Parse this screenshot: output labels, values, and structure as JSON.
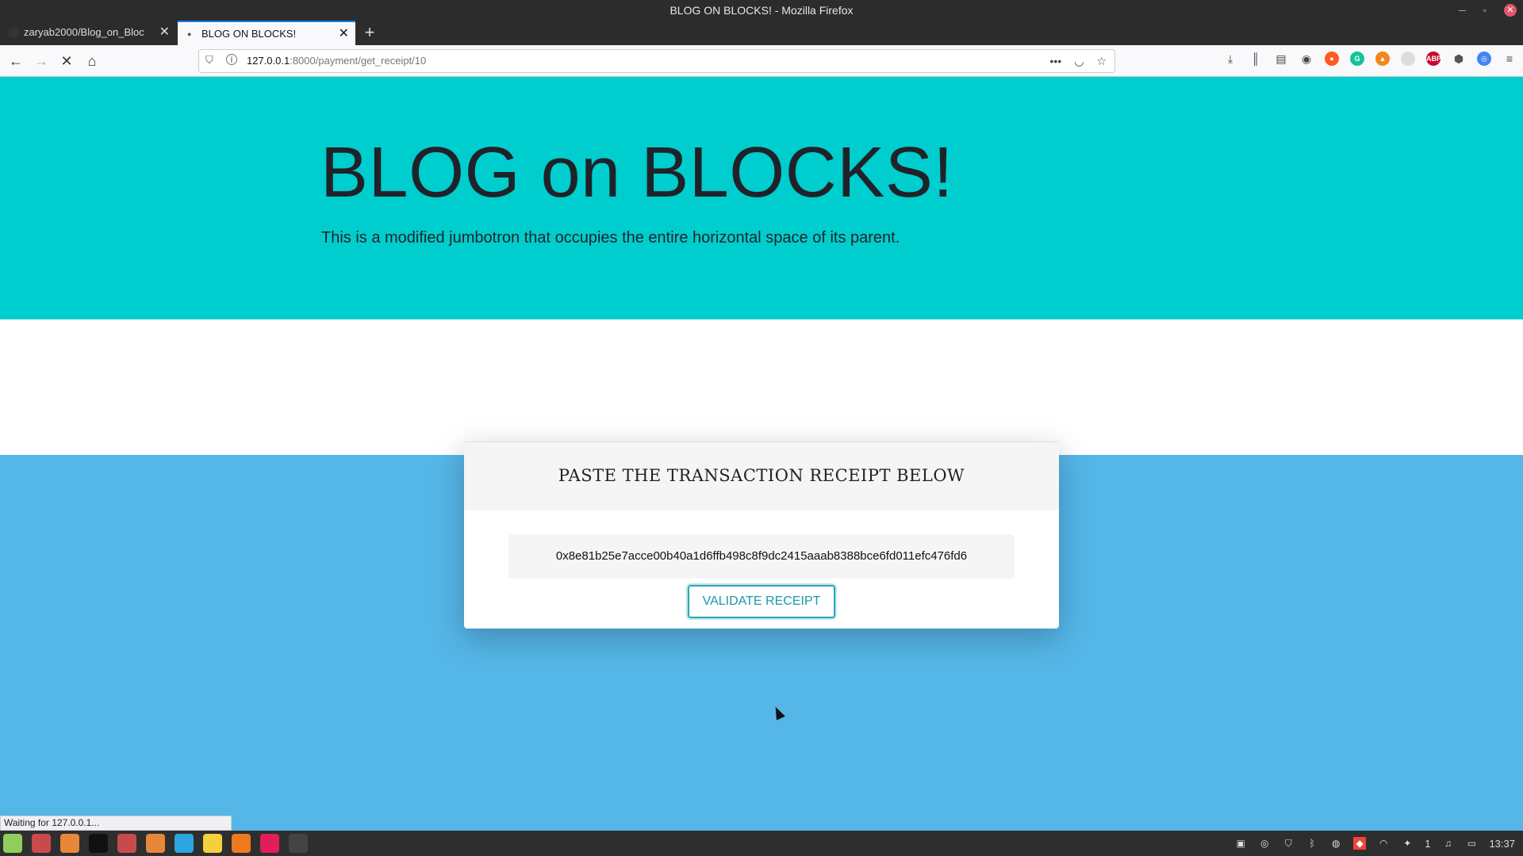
{
  "window": {
    "title": "BLOG ON BLOCKS! - Mozilla Firefox"
  },
  "tabs": [
    {
      "label": "zaryab2000/Blog_on_Bloc"
    },
    {
      "label": "BLOG ON BLOCKS!"
    }
  ],
  "address_bar": {
    "host": "127.0.0.1",
    "path": ":8000/payment/get_receipt/10"
  },
  "jumbotron": {
    "title": "BLOG on BLOCKS!",
    "subtitle": "This is a modified jumbotron that occupies the entire horizontal space of its parent."
  },
  "receipt_card": {
    "heading": "PASTE THE TRANSACTION RECEIPT BELOW",
    "receipt_value": "0x8e81b25e7acce00b40a1d6ffb498c8f9dc2415aaab8388bce6fd011efc476fd6",
    "validate_label": "VALIDATE RECEIPT"
  },
  "status_bar": {
    "text": "Waiting for 127.0.0.1..."
  },
  "taskbar": {
    "clock": "13:37",
    "tray_count": "1"
  },
  "colors": {
    "jumbotron": "#00cdcd",
    "page_background": "#55b6e8",
    "button_accent": "#29a8b4"
  },
  "icons": [
    "back-arrow-icon",
    "forward-arrow-icon",
    "stop-icon",
    "home-icon",
    "shield-icon",
    "info-icon",
    "more-icon",
    "pocket-icon",
    "star-icon",
    "download-icon",
    "library-icon",
    "sidebar-icon",
    "account-icon",
    "menu-icon"
  ]
}
